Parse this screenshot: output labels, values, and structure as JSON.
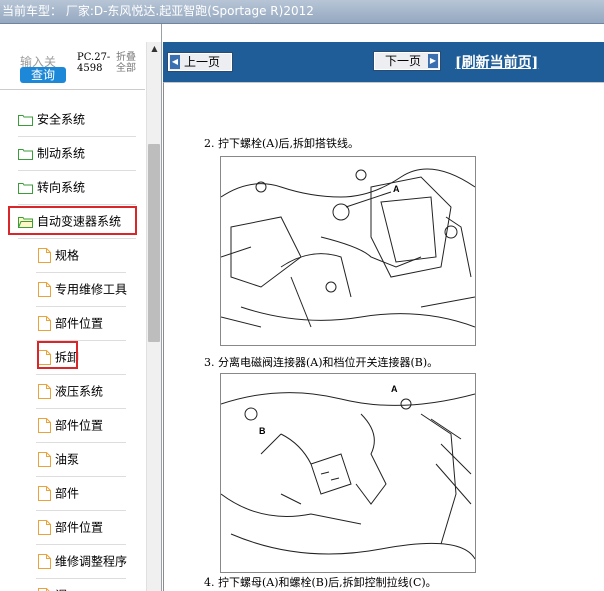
{
  "window": {
    "title": "当前车型：  厂家:D-东风悦达.起亚智跑(Sportage R)2012"
  },
  "search": {
    "prefix_label": "输入关",
    "button_label": "查询",
    "code_line1": "PC.27-",
    "code_line2": "4598",
    "fold_line1": "折叠",
    "fold_line2": "全部"
  },
  "tree": {
    "items": [
      {
        "label": "安全系统",
        "type": "folder"
      },
      {
        "label": "制动系统",
        "type": "folder"
      },
      {
        "label": "转向系统",
        "type": "folder"
      },
      {
        "label": "自动变速器系统",
        "type": "folder-open"
      },
      {
        "label": "规格",
        "type": "doc"
      },
      {
        "label": "专用维修工具",
        "type": "doc"
      },
      {
        "label": "部件位置",
        "type": "doc"
      },
      {
        "label": "拆卸",
        "type": "doc"
      },
      {
        "label": "液压系统",
        "type": "doc"
      },
      {
        "label": "部件位置",
        "type": "doc"
      },
      {
        "label": "油泵",
        "type": "doc"
      },
      {
        "label": "部件",
        "type": "doc"
      },
      {
        "label": "部件位置",
        "type": "doc"
      },
      {
        "label": "维修调整程序",
        "type": "doc"
      },
      {
        "label": "调...",
        "type": "doc"
      }
    ]
  },
  "nav": {
    "prev_label": "上一页",
    "next_label": "下一页",
    "refresh_label": "[刷新当前页]"
  },
  "document": {
    "step2": "2. 拧下螺栓(A)后,拆卸搭铁线。",
    "step3": "3. 分离电磁阀连接器(A)和档位开关连接器(B)。",
    "step4": "4. 拧下螺母(A)和螺栓(B)后,拆卸控制拉线(C)。",
    "fig1_label_a": "A",
    "fig2_label_a": "A",
    "fig2_label_b": "B"
  },
  "colors": {
    "nav_bar": "#1f5d99",
    "highlight": "#d9262b",
    "search_button": "#1e88d8",
    "folder_icon": "#3a9d3a",
    "doc_icon": "#e8a33a"
  }
}
